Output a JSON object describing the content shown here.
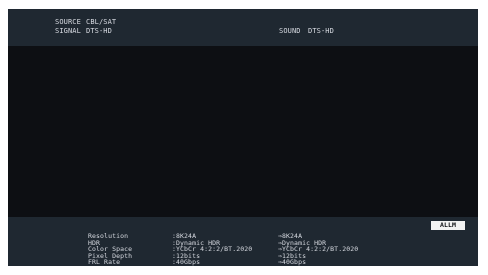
{
  "header": {
    "source_label": "SOURCE",
    "source_value": "CBL/SAT",
    "signal_label": "SIGNAL",
    "signal_value": "DTS-HD",
    "sound_label": "SOUND",
    "sound_value": "DTS-HD"
  },
  "info": {
    "labels": [
      "Resolution",
      "HDR",
      "Color Space",
      "Pixel Depth",
      "FRL Rate"
    ],
    "input_values": [
      ":8K24A",
      ":Dynamic HDR",
      ":YCbCr 4:2:2/BT.2020",
      ":12bits",
      ":40Gbps"
    ],
    "output_values": [
      "⇒8K24A",
      "⇒Dynamic HDR",
      "⇒YCbCr 4:2:2/BT.2020",
      "⇒12bits",
      "⇒40Gbps"
    ]
  },
  "badge": {
    "label": "ALLM"
  },
  "colors": {
    "screen_background": "#0d0f13",
    "panel_background": "#1f2831",
    "text": "#d8dbe2",
    "badge_background": "#f2f2f2"
  }
}
